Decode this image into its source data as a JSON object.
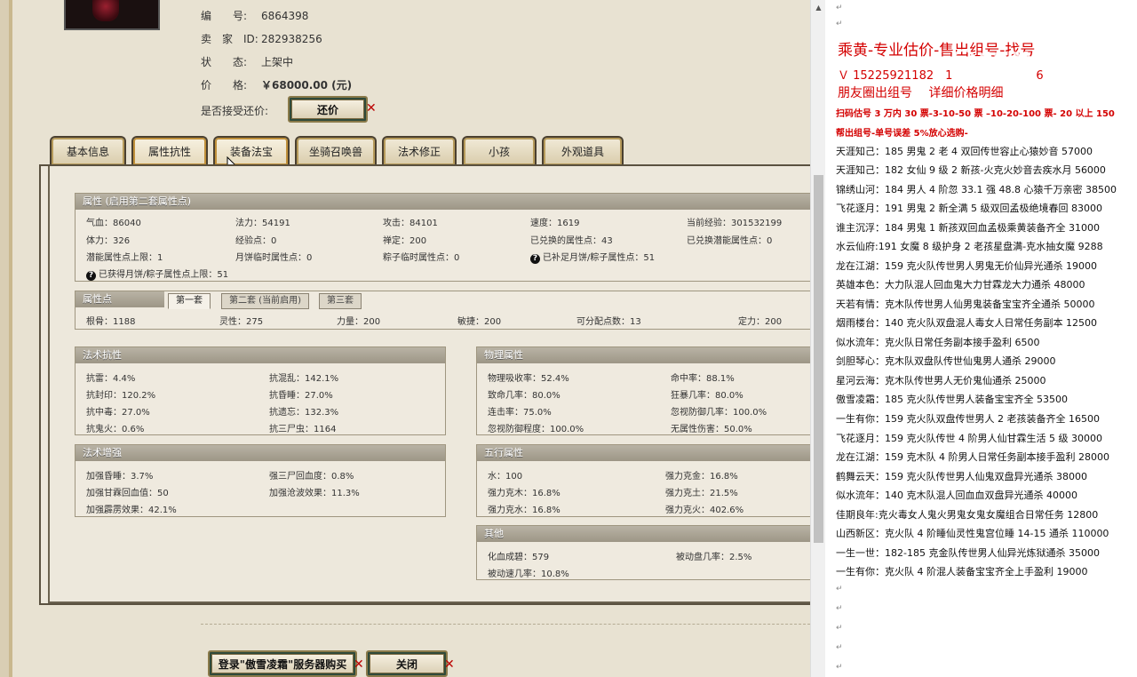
{
  "info": {
    "number_label": "编　　号:",
    "number_value": "6864398",
    "seller_label": "卖　家　ID:",
    "seller_value": "282938256",
    "status_label": "状　　态:",
    "status_value": "上架中",
    "price_label": "价　　格:",
    "price_value": "￥68000.00 (元)",
    "bargain_label": "是否接受还价:",
    "bargain_button": "还价"
  },
  "tabs": [
    "基本信息",
    "属性抗性",
    "装备法宝",
    "坐骑召唤兽",
    "法术修正",
    "小孩",
    "外观道具"
  ],
  "attr": {
    "header": "属性 (启用第二套属性点)",
    "row1": [
      "气血：86040",
      "法力：54191",
      "攻击：84101",
      "速度：1619",
      "当前经验：301532199"
    ],
    "row2": [
      "体力：326",
      "经验点：0",
      "禅定：200",
      "已兑换的属性点：43",
      "已兑换潜能属性点：0"
    ],
    "row3": [
      "潜能属性点上限：1",
      "月饼临时属性点：0",
      "粽子临时属性点：0",
      "已补足月饼/粽子属性点：51"
    ],
    "row4": "已获得月饼/粽子属性点上限：51"
  },
  "points": {
    "header": "属性点",
    "subtabs": [
      "第一套",
      "第二套 (当前启用)",
      "第三套"
    ],
    "values": [
      "根骨：1188",
      "灵性：275",
      "力量：200",
      "敏捷：200",
      "可分配点数：13",
      "定力：200"
    ]
  },
  "resist": {
    "header": "法术抗性",
    "cells": [
      "抗雷：4.4%",
      "抗混乱：142.1%",
      "抗封印：120.2%",
      "抗昏睡：27.0%",
      "抗中毒：27.0%",
      "抗遗忘：132.3%",
      "抗鬼火：0.6%",
      "抗三尸虫：1164"
    ]
  },
  "boost": {
    "header": "法术增强",
    "cells": [
      "加强昏睡：3.7%",
      "强三尸回血度：0.8%",
      "加强甘霖回血值：50",
      "加强沧波效果：11.3%",
      "加强霹雳效果：42.1%"
    ]
  },
  "phys": {
    "header": "物理属性",
    "cells": [
      "物理吸收率：52.4%",
      "命中率：88.1%",
      "致命几率：80.0%",
      "狂暴几率：80.0%",
      "连击率：75.0%",
      "忽视防御几率：100.0%",
      "忽视防御程度：100.0%",
      "无属性伤害：50.0%"
    ]
  },
  "five": {
    "header": "五行属性",
    "cells": [
      "水：100",
      "强力克金：16.8%",
      "强力克木：16.8%",
      "强力克土：21.5%",
      "强力克水：16.8%",
      "强力克火：402.6%"
    ]
  },
  "other": {
    "header": "其他",
    "cells": [
      "化血成碧：579",
      "被动盘几率：2.5%",
      "被动速几率：10.8%"
    ]
  },
  "bottom": {
    "login_button": "登录\"傲雪凌霜\"服务器购买",
    "close_button": "关闭"
  },
  "doc": {
    "title": "乘黄-专业估价-售出组号-找号",
    "phone": "Ｖ 15225921182　1",
    "phone2": "6",
    "subtitle": "朋友圈出组号　 详细价格明细",
    "rule1": "扫码估号 3 万内 30 票-3-10-50 票 –10-20-100 票- 20 以上 150",
    "rule2": "帮出组号-单号误差 5%放心选购-",
    "watermark": "CSDN",
    "lines": [
      "天涯知己：185 男鬼 2 老 4 双回传世容止心猿妙音 57000",
      "天涯知己：182 女仙 9 级 2 新孩-火克火妙音去疾水月 56000",
      "锦绣山河：184 男人 4 阶忽 33.1 强 48.8 心猿千万亲密 38500",
      "飞花逐月：191 男鬼 2 新全满 5 级双回孟极绝境春回 83000",
      "谁主沉浮：184 男鬼 1 新孩双回血孟极乘黄装备齐全 31000",
      "水云仙府:191 女魔 8 级护身 2 老孩星盘满-克水抽女魔 9288",
      "龙在江湖：159 克火队传世男人男鬼无价仙异光通杀 19000",
      "英雄本色：大力队混人回血鬼大力甘霖龙大力通杀 48000",
      "天若有情：克木队传世男人仙男鬼装备宝宝齐全通杀 50000",
      "烟雨楼台：140 克火队双盘混人毒女人日常任务副本 12500",
      "似水流年：克火队日常任务副本接手盈利 6500",
      "剑胆琴心：克木队双盘队传世仙鬼男人通杀 29000",
      "星河云海：克木队传世男人无价鬼仙通杀 25000",
      "傲雪凌霜：185 克火队传世男人装备宝宝齐全 53500",
      "一生有你：159 克火队双盘传世男人 2 老孩装备齐全 16500",
      "飞花逐月：159 克火队传世 4 阶男人仙甘霖生活 5 级 30000",
      "龙在江湖：159 克木队 4 阶男人日常任务副本接手盈利 28000",
      "鹤舞云天：159 克火队传世男人仙鬼双盘异光通杀 38000",
      "似水流年：140 克木队混人回血血双盘异光通杀 40000",
      "佳期良年:克火毒女人鬼火男鬼女鬼女魔组合日常任务 12800",
      "山西新区：克火队 4 阶睡仙灵性鬼宫位睡 14-15 通杀 110000",
      "一生一世：182-185 克金队传世男人仙异光炼狱通杀 35000",
      "一生有你：克火队 4 阶混人装备宝宝齐全上手盈利 19000"
    ]
  }
}
